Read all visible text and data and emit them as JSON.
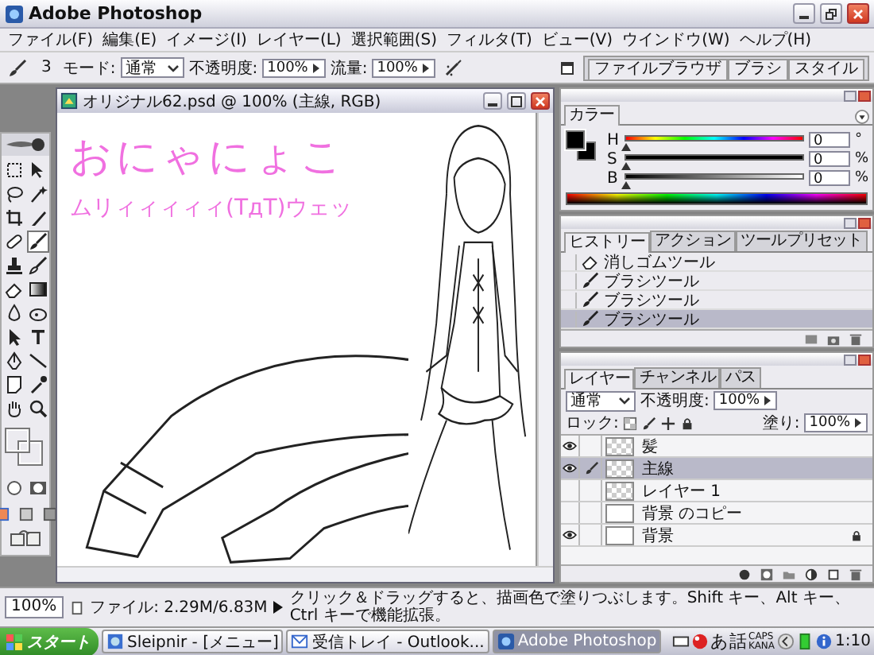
{
  "window": {
    "title": "Adobe Photoshop"
  },
  "menu": [
    "ファイル(F)",
    "編集(E)",
    "イメージ(I)",
    "レイヤー(L)",
    "選択範囲(S)",
    "フィルタ(T)",
    "ビュー(V)",
    "ウインドウ(W)",
    "ヘルプ(H)"
  ],
  "options_bar": {
    "brush_size": "3",
    "mode_label": "モード:",
    "mode": "通常",
    "opacity_label": "不透明度:",
    "opacity": "100%",
    "flow_label": "流量:",
    "flow": "100%"
  },
  "palette_well": [
    "ファイルブラウザ",
    "ブラシ",
    "スタイル"
  ],
  "toolbox": {
    "tools": [
      {
        "kind": "marquee",
        "selected": false
      },
      {
        "kind": "move",
        "selected": false
      },
      {
        "kind": "lasso",
        "selected": false
      },
      {
        "kind": "wand",
        "selected": false
      },
      {
        "kind": "crop",
        "selected": false
      },
      {
        "kind": "slice",
        "selected": false
      },
      {
        "kind": "heal",
        "selected": false
      },
      {
        "kind": "brush",
        "selected": true
      },
      {
        "kind": "stamp",
        "selected": false
      },
      {
        "kind": "history",
        "selected": false
      },
      {
        "kind": "eraser",
        "selected": false
      },
      {
        "kind": "gradient",
        "selected": false
      },
      {
        "kind": "blur",
        "selected": false
      },
      {
        "kind": "dodge",
        "selected": false
      },
      {
        "kind": "select",
        "selected": false
      },
      {
        "kind": "type",
        "selected": false
      },
      {
        "kind": "pen",
        "selected": false
      },
      {
        "kind": "line",
        "selected": false
      },
      {
        "kind": "notes",
        "selected": false
      },
      {
        "kind": "eyedropper",
        "selected": false
      },
      {
        "kind": "hand",
        "selected": false
      },
      {
        "kind": "zoom",
        "selected": false
      }
    ]
  },
  "document": {
    "title": "オリジナル62.psd @ 100% (主線, RGB)",
    "canvas_text": [
      "おにゃにょこ",
      "ムリィィィィィ(TдT)ウェッ"
    ]
  },
  "color_panel": {
    "tab": "カラー",
    "channels": [
      {
        "name": "H",
        "value": "0",
        "unit": "°",
        "level": 0,
        "kind": "hue"
      },
      {
        "name": "S",
        "value": "0",
        "unit": "%",
        "level": 0,
        "kind": "saturation"
      },
      {
        "name": "B",
        "value": "0",
        "unit": "%",
        "level": 0,
        "kind": "brightness"
      }
    ]
  },
  "history_panel": {
    "tabs": [
      {
        "label": "ヒストリー",
        "selected": true
      },
      {
        "label": "アクション",
        "selected": false
      },
      {
        "label": "ツールプリセット",
        "selected": false
      }
    ],
    "items": [
      {
        "label": "消しゴムツール",
        "kind": "eraser",
        "selected": false
      },
      {
        "label": "ブラシツール",
        "kind": "brush",
        "selected": false
      },
      {
        "label": "ブラシツール",
        "kind": "brush",
        "selected": false
      },
      {
        "label": "ブラシツール",
        "kind": "brush",
        "selected": true
      }
    ]
  },
  "layers_panel": {
    "tabs": [
      {
        "label": "レイヤー",
        "selected": true
      },
      {
        "label": "チャンネル",
        "selected": false
      },
      {
        "label": "パス",
        "selected": false
      }
    ],
    "blend_mode": "通常",
    "opacity_label": "不透明度:",
    "opacity": "100%",
    "lock_label": "ロック:",
    "fill_label": "塗り:",
    "fill": "100%",
    "layers": [
      {
        "name": "髪",
        "visible": true,
        "selected": false,
        "locked": false,
        "kind": "transparent"
      },
      {
        "name": "主線",
        "visible": true,
        "selected": true,
        "locked": false,
        "kind": "transparent"
      },
      {
        "name": "レイヤー 1",
        "visible": false,
        "selected": false,
        "locked": false,
        "kind": "transparent"
      },
      {
        "name": "背景 のコピー",
        "visible": false,
        "selected": false,
        "locked": false,
        "kind": "white"
      },
      {
        "name": "背景",
        "visible": true,
        "selected": false,
        "locked": true,
        "kind": "white"
      }
    ]
  },
  "status_bar": {
    "zoom": "100%",
    "file_info": "ファイル: 2.29M/6.83M",
    "message": "クリック＆ドラッグすると、描画色で塗りつぶします。Shift キー、Alt キー、Ctrl キーで機能拡張。"
  },
  "taskbar": {
    "start": "スタート",
    "tasks": [
      {
        "label": "Sleipnir - [メニュー]",
        "kind": "browser",
        "selected": false
      },
      {
        "label": "受信トレイ - Outlook...",
        "kind": "mail",
        "selected": false
      },
      {
        "label": "Adobe Photoshop",
        "kind": "photoshop",
        "selected": true
      }
    ],
    "ime": [
      "あ",
      "話"
    ],
    "caps": "CAPS",
    "kana": "KANA",
    "clock": "1:10"
  }
}
